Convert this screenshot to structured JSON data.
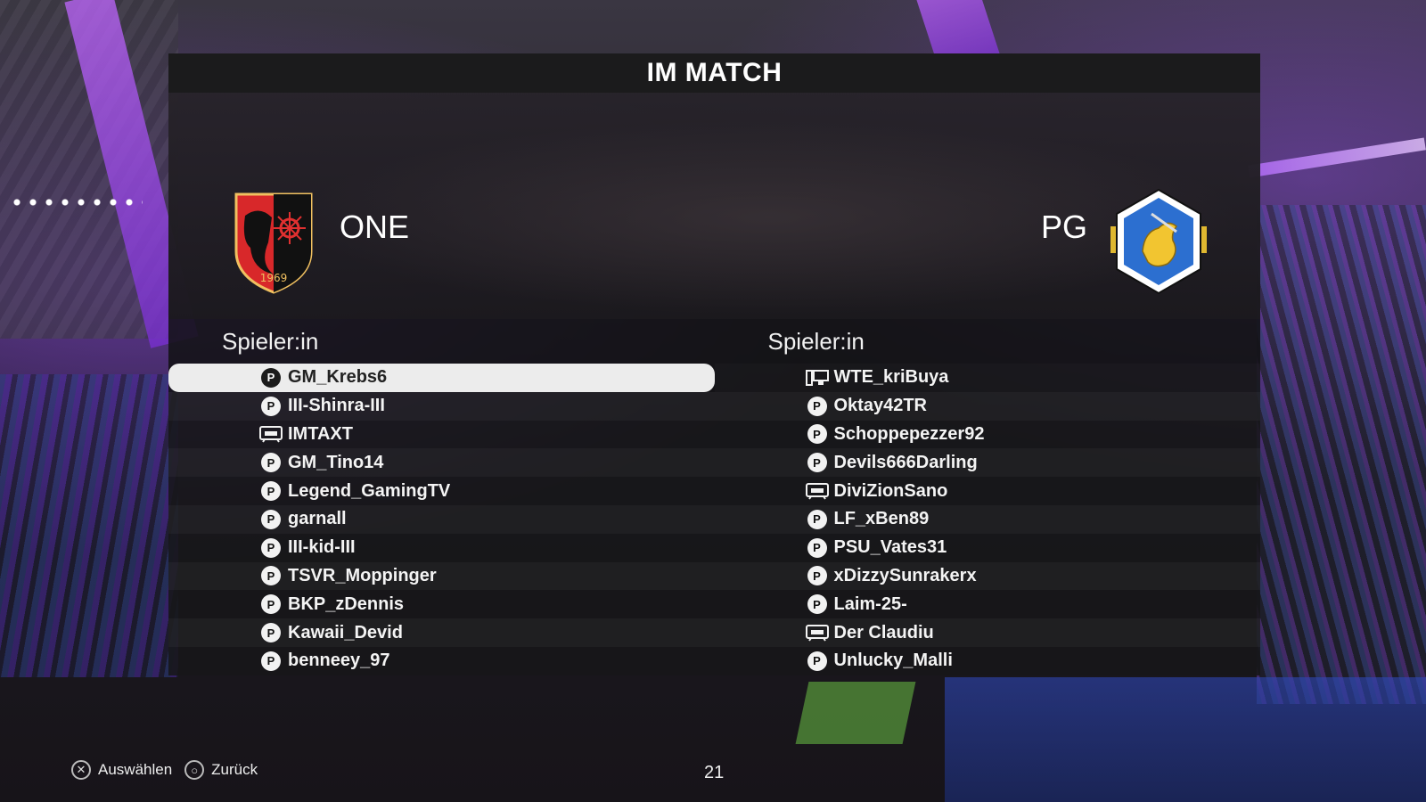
{
  "title": "IM MATCH",
  "home_team": {
    "name": "ONE",
    "crest_icon": "eagle-shield-crest",
    "crest_year": "1969"
  },
  "away_team": {
    "name": "PG",
    "crest_icon": "griffin-hexagon-crest"
  },
  "columns": {
    "left_header": "Spieler:in",
    "right_header": "Spieler:in"
  },
  "left_players": [
    {
      "name": "GM_Krebs6",
      "platform": "playstation",
      "selected": true
    },
    {
      "name": "III-Shinra-III",
      "platform": "playstation"
    },
    {
      "name": "IMTAXT",
      "platform": "xbox"
    },
    {
      "name": "GM_Tino14",
      "platform": "playstation"
    },
    {
      "name": "Legend_GamingTV",
      "platform": "playstation"
    },
    {
      "name": "garnall",
      "platform": "playstation"
    },
    {
      "name": "III-kid-III",
      "platform": "playstation"
    },
    {
      "name": "TSVR_Moppinger",
      "platform": "playstation"
    },
    {
      "name": "BKP_zDennis",
      "platform": "playstation"
    },
    {
      "name": "Kawaii_Devid",
      "platform": "playstation"
    },
    {
      "name": "benneey_97",
      "platform": "playstation"
    }
  ],
  "right_players": [
    {
      "name": "WTE_kriBuya",
      "platform": "pc"
    },
    {
      "name": "Oktay42TR",
      "platform": "playstation"
    },
    {
      "name": "Schoppepezzer92",
      "platform": "playstation"
    },
    {
      "name": "Devils666Darling",
      "platform": "playstation"
    },
    {
      "name": "DiviZionSano",
      "platform": "xbox"
    },
    {
      "name": "LF_xBen89",
      "platform": "playstation"
    },
    {
      "name": "PSU_Vates31",
      "platform": "playstation"
    },
    {
      "name": "xDizzySunrakerx",
      "platform": "playstation"
    },
    {
      "name": "Laim-25-",
      "platform": "playstation"
    },
    {
      "name": "Der Claudiu",
      "platform": "xbox"
    },
    {
      "name": "Unlucky_Malli",
      "platform": "playstation"
    }
  ],
  "footer": {
    "select_label": "Auswählen",
    "back_label": "Zurück",
    "page_number": "21"
  },
  "colors": {
    "selected_row": "#ececec",
    "panel": "#121214",
    "accent_purple": "#b56bff"
  }
}
